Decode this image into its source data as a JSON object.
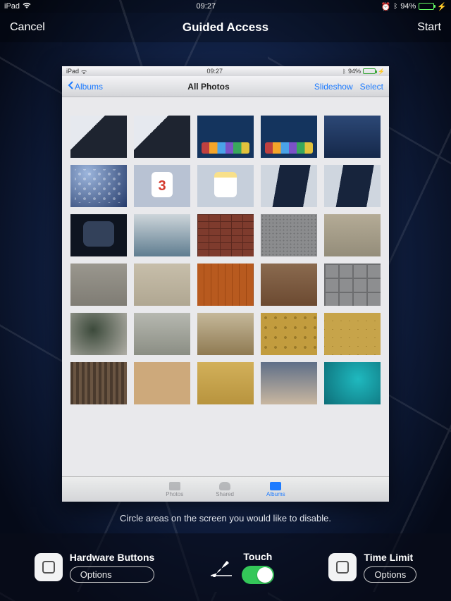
{
  "outer_status": {
    "device": "iPad",
    "time": "09:27",
    "battery_pct": "94%",
    "battery_fill": 94
  },
  "top_bar": {
    "cancel": "Cancel",
    "title": "Guided Access",
    "start": "Start"
  },
  "preview": {
    "status": {
      "device": "iPad",
      "time": "09:27",
      "battery_pct": "94%",
      "battery_fill": 94
    },
    "nav": {
      "back": "Albums",
      "title": "All Photos",
      "slideshow": "Slideshow",
      "select": "Select"
    },
    "tabs": {
      "photos": "Photos",
      "shared": "Shared",
      "albums": "Albums",
      "selected": "albums"
    },
    "thumbs": [
      "th-dev",
      "th-dev",
      "th-dock",
      "th-dock",
      "th-blue",
      "th-home",
      "th-cal",
      "th-notes",
      "th-ipad",
      "th-ipad",
      "th-folder",
      "th-fog",
      "th-brick",
      "th-gravel",
      "th-sand",
      "th-conc1",
      "th-conc2",
      "th-wood",
      "th-rust",
      "th-pavers",
      "th-moss",
      "th-stone",
      "th-peel",
      "th-mud",
      "th-crackmud",
      "th-bark",
      "th-stuc",
      "th-paper",
      "th-sky",
      "th-water"
    ]
  },
  "hint": "Circle areas on the screen you would like to disable.",
  "bottom": {
    "hardware": {
      "label": "Hardware Buttons",
      "options": "Options"
    },
    "touch": {
      "label": "Touch",
      "on": true
    },
    "timelimit": {
      "label": "Time Limit",
      "options": "Options"
    }
  }
}
